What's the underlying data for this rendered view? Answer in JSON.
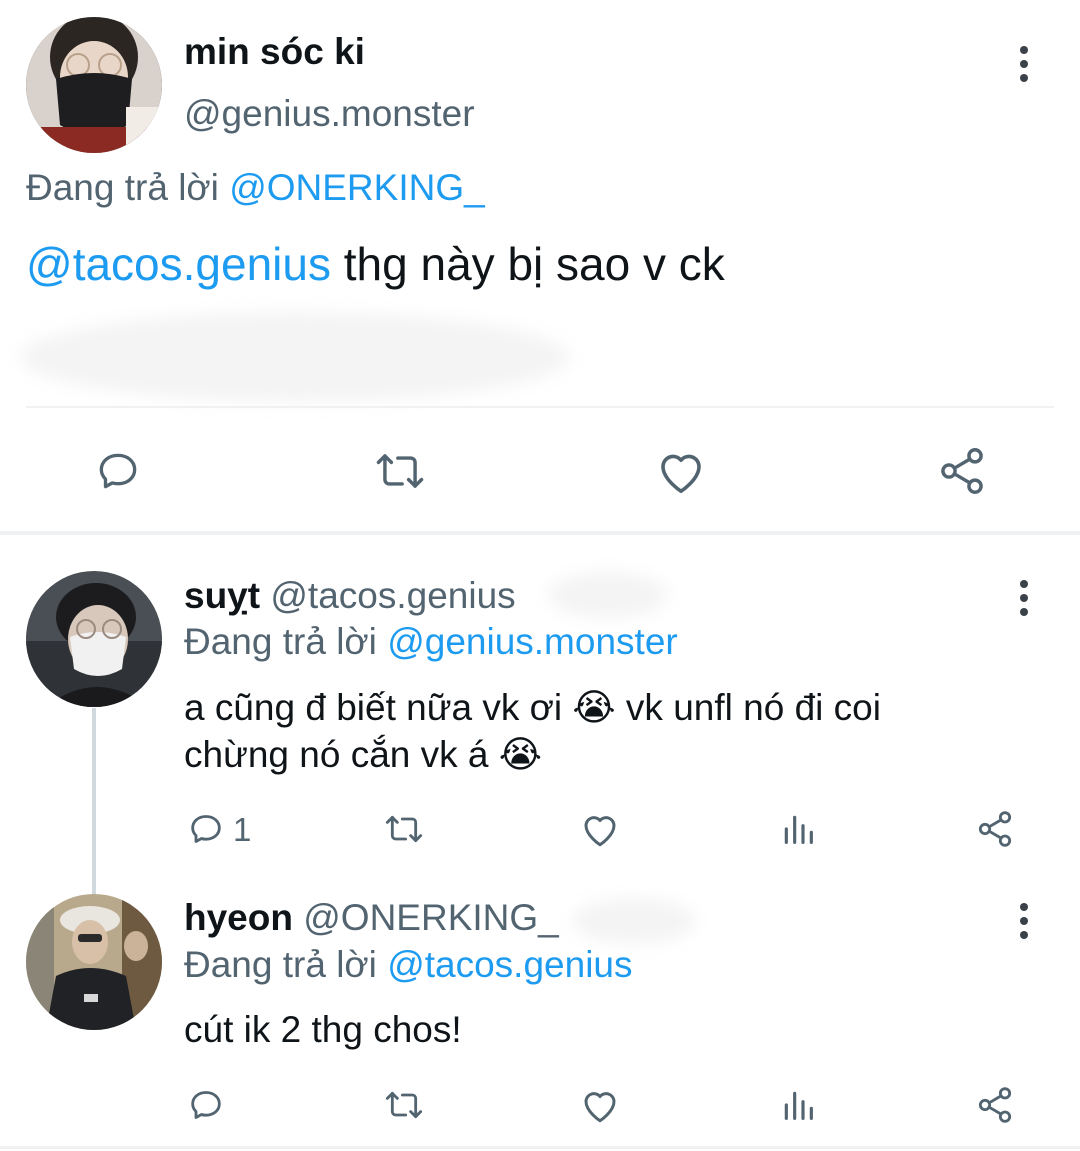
{
  "main_tweet": {
    "display_name": "min sóc ki",
    "handle": "@genius.monster",
    "replying_prefix": "Đang trả lời",
    "replying_to": "@ONERKING_",
    "mention": "@tacos.genius",
    "text": " thg này bị sao v ck"
  },
  "replies": [
    {
      "display_name": "suỵt",
      "handle": "@tacos.genius",
      "replying_prefix": "Đang trả lời",
      "replying_to": "@genius.monster",
      "text_line1": "a cũng đ biết nữa vk ơi 😭 vk unfl nó đi coi",
      "text_line2": "chừng nó cắn vk á 😭",
      "reply_count": "1"
    },
    {
      "display_name": "hyeon",
      "handle": "@ONERKING_",
      "replying_prefix": "Đang trả lời",
      "replying_to": "@tacos.genius",
      "text": "cút ik 2 thg chos!",
      "reply_count": ""
    }
  ],
  "icons": {
    "reply": "reply-bubble-icon",
    "retweet": "retweet-icon",
    "like": "heart-icon",
    "share": "share-icon",
    "views": "views-icon",
    "more": "more-vertical-icon"
  },
  "colors": {
    "accent": "#1d9bf0",
    "text": "#0f1419",
    "muted": "#536471",
    "icon": "#536471"
  }
}
